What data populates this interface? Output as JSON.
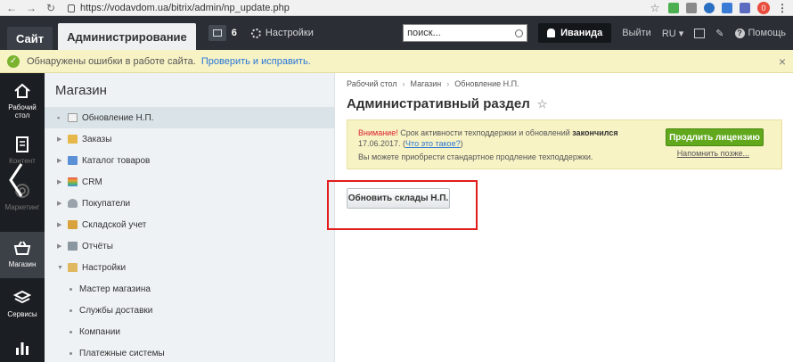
{
  "browser": {
    "url": "https://vodavdom.ua/bitrix/admin/np_update.php",
    "profile_badge": "0"
  },
  "topbar": {
    "site_tab": "Сайт",
    "admin_tab": "Администрирование",
    "notifications_count": "6",
    "settings_label": "Настройки",
    "search_placeholder": "поиск...",
    "user_name": "Иванида",
    "logout_label": "Выйти",
    "lang": "RU",
    "help_label": "Помощь"
  },
  "warning": {
    "message": "Обнаружены ошибки в работе сайта.",
    "link": "Проверить и исправить."
  },
  "iconmenu": {
    "items": [
      {
        "label": "Рабочий стол"
      },
      {
        "label": "Контент"
      },
      {
        "label": "Маркетинг"
      },
      {
        "label": "Магазин"
      },
      {
        "label": "Сервисы"
      }
    ]
  },
  "sidebar": {
    "title": "Магазин",
    "items": [
      {
        "label": "Обновление Н.П."
      },
      {
        "label": "Заказы"
      },
      {
        "label": "Каталог товаров"
      },
      {
        "label": "CRM"
      },
      {
        "label": "Покупатели"
      },
      {
        "label": "Складской учет"
      },
      {
        "label": "Отчёты"
      },
      {
        "label": "Настройки"
      }
    ],
    "subitems": [
      {
        "label": "Мастер магазина"
      },
      {
        "label": "Службы доставки"
      },
      {
        "label": "Компании"
      },
      {
        "label": "Платежные системы"
      }
    ]
  },
  "main": {
    "breadcrumbs": [
      "Рабочий стол",
      "Магазин",
      "Обновление Н.П."
    ],
    "title": "Административный раздел",
    "license": {
      "warn_word": "Внимание!",
      "text_a": " Срок активности техподдержки и обновлений ",
      "text_b": "закончился",
      "date_text": " 17.06.2017. (",
      "what_link": "Что это такое?",
      "close_paren": ")",
      "line2": "Вы можете приобрести стандартное продление техподдержки.",
      "buy_button": "Продлить лицензию",
      "remind_later": "Напомнить позже..."
    },
    "action_button": "Обновить склады Н.П."
  }
}
